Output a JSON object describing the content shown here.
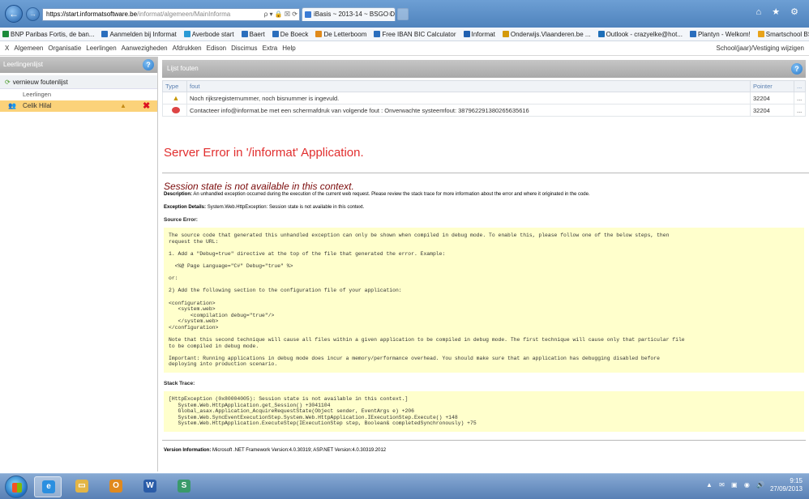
{
  "browser": {
    "address_host": "https://start.informatsoftware.be",
    "address_path": "/informat/algemeen/MainInforma",
    "address_controls": "ρ ▾ 🔒 ☒ ⟳",
    "tab_title": "iBasis ~ 2013-14 ~ BSGO De...",
    "tab_close": "×",
    "window_icons": "⌂ ★ ⚙",
    "back_glyph": "←",
    "forward_glyph": "→",
    "favorites": [
      {
        "label": "BNP Paribas Fortis, de ban...",
        "color": "#1a8a3a"
      },
      {
        "label": "Aanmelden bij Informat",
        "color": "#2a6ebd"
      },
      {
        "label": "Averbode start",
        "color": "#2a9ad5"
      },
      {
        "label": "Baert",
        "color": "#2a6ebd"
      },
      {
        "label": "De Boeck",
        "color": "#2a6ebd"
      },
      {
        "label": "De Letterboom",
        "color": "#e08a1a"
      },
      {
        "label": "Free IBAN BIC Calculator",
        "color": "#2a6ebd"
      },
      {
        "label": "Informat",
        "color": "#2060b0"
      },
      {
        "label": "Onderwijs.Vlaanderen.be ...",
        "color": "#d49a0a"
      },
      {
        "label": "Outlook - crazyelke@hot...",
        "color": "#1e6fb8"
      },
      {
        "label": "Plantyn - Welkom!",
        "color": "#2a6ebd"
      },
      {
        "label": "Smartschool BSVH",
        "color": "#e8a31a"
      }
    ]
  },
  "menu": {
    "items": [
      "X",
      "Algemeen",
      "Organisatie",
      "Leerlingen",
      "Aanwezigheden",
      "Afdrukken",
      "Edison",
      "Discimus",
      "Extra",
      "Help"
    ],
    "right": "School(jaar)/Vestiging wijzigen"
  },
  "left": {
    "title": "Leerlingenlijst",
    "help": "?",
    "refresh": "vernieuw foutenlijst",
    "refresh_glyph": "⟳",
    "sub": "Leerlingen",
    "row": "Celik Hilal",
    "person_glyph": "👥",
    "warn_glyph": "▲",
    "delete_glyph": "✖"
  },
  "main": {
    "title": "Lijst fouten",
    "help": "?",
    "columns": [
      "Type",
      "fout",
      "Pointer",
      "..."
    ],
    "rows": [
      {
        "fout": "Noch rijksregisternummer, noch bisnummer is ingevuld.",
        "pointer": "32204",
        "more": "..."
      },
      {
        "fout": "Contacteer info@informat.be met een schermafdruk van volgende fout : Onverwachte systeemfout: 387962291380265635616",
        "pointer": "32204",
        "more": "..."
      }
    ],
    "warn_glyph": "▲"
  },
  "error": {
    "heading": "Server Error in '/informat' Application.",
    "subheading": "Session state is not available in this context.",
    "description_label": "Description:",
    "description": "An unhandled exception occurred during the execution of the current web request. Please review the stack trace for more information about the error and where it originated in the code.",
    "exception_label": "Exception Details:",
    "exception": "System.Web.HttpException: Session state is not available in this context.",
    "source_label": "Source Error:",
    "source_code": "The source code that generated this unhandled exception can only be shown when compiled in debug mode. To enable this, please follow one of the below steps, then\nrequest the URL:\n\n1. Add a \"Debug=true\" directive at the top of the file that generated the error. Example:\n\n  <%@ Page Language=\"C#\" Debug=\"true\" %>\n\nor:\n\n2) Add the following section to the configuration file of your application:\n\n<configuration>\n   <system.web>\n       <compilation debug=\"true\"/>\n   </system.web>\n</configuration>\n\nNote that this second technique will cause all files within a given application to be compiled in debug mode. The first technique will cause only that particular file\nto be compiled in debug mode.\n\nImportant: Running applications in debug mode does incur a memory/performance overhead. You should make sure that an application has debugging disabled before\ndeploying into production scenario.",
    "stack_label": "Stack Trace:",
    "stack": "[HttpException (0x80004005): Session state is not available in this context.]\n   System.Web.HttpApplication.get_Session() +3041104\n   Global_asax.Application_AcquireRequestState(Object sender, EventArgs e) +206\n   System.Web.SyncEventExecutionStep.System.Web.HttpApplication.IExecutionStep.Execute() +148\n   System.Web.HttpApplication.ExecuteStep(IExecutionStep step, Boolean& completedSynchronously) +75",
    "version_label": "Version Information:",
    "version": "Microsoft .NET Framework Version:4.0.30319; ASP.NET Version:4.0.30319.2012"
  },
  "taskbar": {
    "apps": [
      {
        "name": "internet-explorer",
        "glyph": "e",
        "color": "#2b8fe0"
      },
      {
        "name": "file-explorer",
        "glyph": "▭",
        "color": "#e3b545"
      },
      {
        "name": "outlook",
        "glyph": "O",
        "color": "#e0891e"
      },
      {
        "name": "word",
        "glyph": "W",
        "color": "#2a5ca8"
      },
      {
        "name": "app-s",
        "glyph": "S",
        "color": "#3a9a6a"
      }
    ],
    "tray_icons": "▲ ✉ ▣ ◉ 🔊",
    "time": "9:15",
    "date": "27/09/2013"
  }
}
